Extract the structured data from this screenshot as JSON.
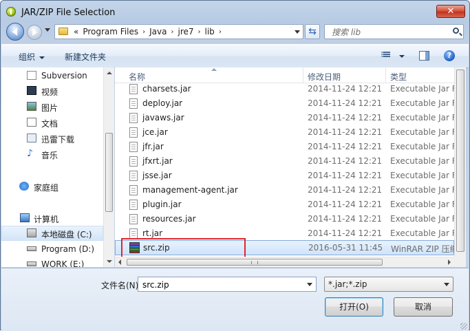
{
  "window": {
    "title": "JAR/ZIP File Selection",
    "close_label": "✕"
  },
  "address": {
    "crumbs": [
      "«",
      "Program Files",
      "Java",
      "jre7",
      "lib"
    ],
    "separator": "›",
    "search_placeholder": "搜索 lib"
  },
  "toolbar": {
    "organize": "组织",
    "new_folder": "新建文件夹",
    "help": "?"
  },
  "sidebar": {
    "items": [
      {
        "label": "Subversion",
        "icon": "svn-doc-icon"
      },
      {
        "label": "视频",
        "icon": "video-library-icon"
      },
      {
        "label": "图片",
        "icon": "pictures-library-icon"
      },
      {
        "label": "文档",
        "icon": "documents-library-icon"
      },
      {
        "label": "迅雷下载",
        "icon": "download-library-icon"
      },
      {
        "label": "音乐",
        "icon": "music-library-icon"
      },
      {
        "label": "家庭组",
        "icon": "homegroup-icon"
      },
      {
        "label": "计算机",
        "icon": "computer-icon"
      },
      {
        "label": "本地磁盘 (C:)",
        "icon": "drive-c-icon"
      },
      {
        "label": "Program (D:)",
        "icon": "drive-icon"
      },
      {
        "label": "WORK (E:)",
        "icon": "drive-icon"
      }
    ]
  },
  "filelist": {
    "columns": {
      "name": "名称",
      "date": "修改日期",
      "type": "类型"
    },
    "rows": [
      {
        "name": "charsets.jar",
        "date": "2014-11-24 12:21",
        "type": "Executable Jar F"
      },
      {
        "name": "deploy.jar",
        "date": "2014-11-24 12:21",
        "type": "Executable Jar F"
      },
      {
        "name": "javaws.jar",
        "date": "2014-11-24 12:21",
        "type": "Executable Jar F"
      },
      {
        "name": "jce.jar",
        "date": "2014-11-24 12:21",
        "type": "Executable Jar F"
      },
      {
        "name": "jfr.jar",
        "date": "2014-11-24 12:21",
        "type": "Executable Jar F"
      },
      {
        "name": "jfxrt.jar",
        "date": "2014-11-24 12:21",
        "type": "Executable Jar F"
      },
      {
        "name": "jsse.jar",
        "date": "2014-11-24 12:21",
        "type": "Executable Jar F"
      },
      {
        "name": "management-agent.jar",
        "date": "2014-11-24 12:21",
        "type": "Executable Jar F"
      },
      {
        "name": "plugin.jar",
        "date": "2014-11-24 12:21",
        "type": "Executable Jar F"
      },
      {
        "name": "resources.jar",
        "date": "2014-11-24 12:21",
        "type": "Executable Jar F"
      },
      {
        "name": "rt.jar",
        "date": "2014-11-24 12:21",
        "type": "Executable Jar F"
      },
      {
        "name": "src.zip",
        "date": "2016-05-31 11:45",
        "type": "WinRAR ZIP 压缩"
      }
    ]
  },
  "bottom": {
    "filename_label": "文件名(N):",
    "filename_value": "src.zip",
    "filetype_value": "*.jar;*.zip",
    "open_label": "打开(O)",
    "cancel_label": "取消"
  },
  "colors": {
    "highlight_box": "#e0262b",
    "selection": "#cfe3fa"
  }
}
